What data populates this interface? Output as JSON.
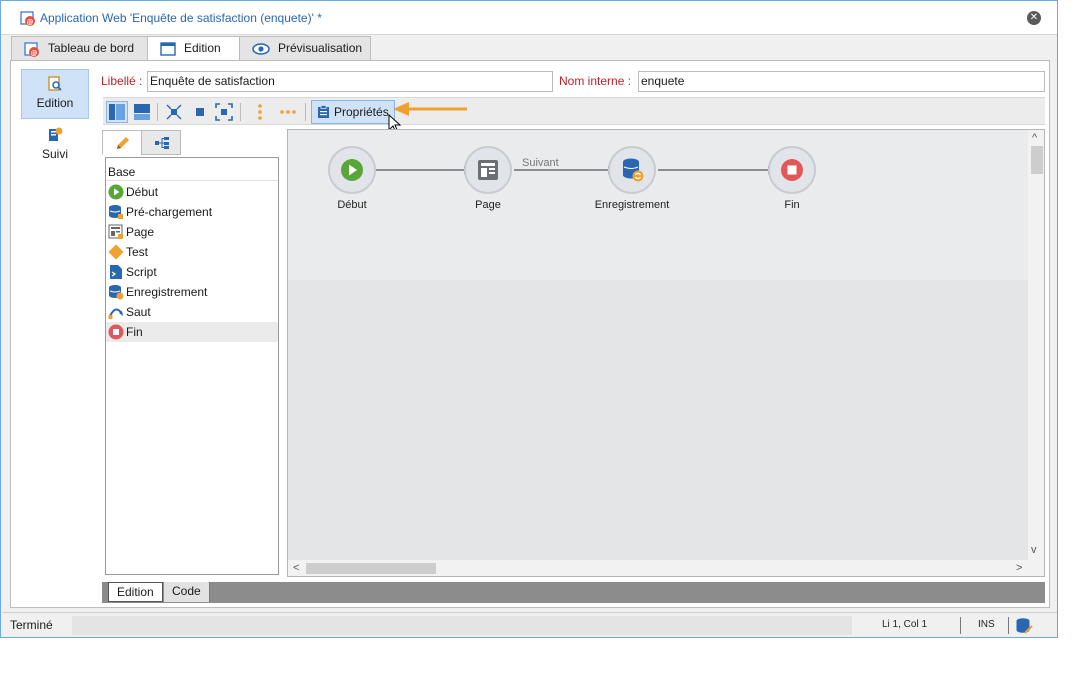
{
  "window": {
    "title": "Application Web 'Enquête de satisfaction (enquete)' *"
  },
  "tabs": [
    {
      "label": "Tableau de bord"
    },
    {
      "label": "Edition"
    },
    {
      "label": "Prévisualisation"
    }
  ],
  "leftnav": [
    {
      "label": "Edition"
    },
    {
      "label": "Suivi"
    }
  ],
  "form": {
    "libelle_label": "Libellé :",
    "libelle_value": "Enquête de satisfaction",
    "nom_interne_label": "Nom interne :",
    "nom_interne_value": "enquete"
  },
  "toolbar": {
    "properties_label": "Propriétés"
  },
  "palette": {
    "header": "Base",
    "items": [
      {
        "label": "Début",
        "icon": "start-icon"
      },
      {
        "label": "Pré-chargement",
        "icon": "preload-icon"
      },
      {
        "label": "Page",
        "icon": "page-icon"
      },
      {
        "label": "Test",
        "icon": "test-icon"
      },
      {
        "label": "Script",
        "icon": "script-icon"
      },
      {
        "label": "Enregistrement",
        "icon": "storage-icon"
      },
      {
        "label": "Saut",
        "icon": "jump-icon"
      },
      {
        "label": "Fin",
        "icon": "end-icon"
      }
    ]
  },
  "workflow": {
    "nodes": [
      {
        "label": "Début"
      },
      {
        "label": "Page"
      },
      {
        "label": "Enregistrement"
      },
      {
        "label": "Fin"
      }
    ],
    "link_label": "Suivant"
  },
  "bottom_tabs": [
    {
      "label": "Edition"
    },
    {
      "label": "Code"
    }
  ],
  "status": {
    "text": "Terminé",
    "position": "Li 1, Col 1",
    "mode": "INS"
  },
  "colors": {
    "accent": "#2a67b1",
    "required_label": "#c0202a",
    "start_green": "#58a637",
    "end_red": "#e25858",
    "indicator_orange": "#f0a030"
  }
}
